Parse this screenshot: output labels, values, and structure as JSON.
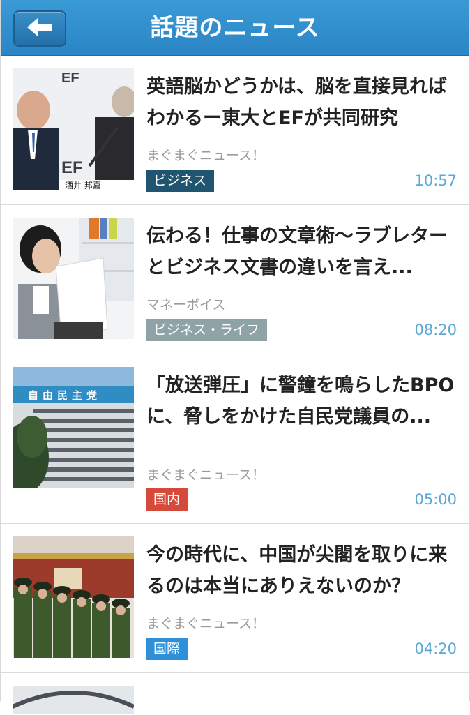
{
  "header": {
    "title": "話題のニュース",
    "back_icon": "arrow-left-icon",
    "color": "#2d8ccb"
  },
  "news": [
    {
      "title": "英語脳かどうかは、脳を直接見ればわかるー東大とEFが共同研究",
      "source": "まぐまぐニュース！",
      "category": "ビジネス",
      "category_color": "#1f5571",
      "time": "10:57",
      "thumb_caption": "酒井 邦嘉",
      "thumb_logo": "EF"
    },
    {
      "title": "伝わる！仕事の文章術〜ラブレターとビジネス文書の違いを言え...",
      "source": "マネーボイス",
      "category": "ビジネス・ライフ",
      "category_color": "#8fa3a6",
      "time": "08:20"
    },
    {
      "title": "「放送弾圧」に警鐘を鳴らしたBPOに、脅しをかけた自民党議員の...",
      "source": "まぐまぐニュース！",
      "category": "国内",
      "category_color": "#d64a3b",
      "time": "05:00",
      "thumb_sign": "自由民主党"
    },
    {
      "title": "今の時代に、中国が尖閣を取りに来るのは本当にありえないのか？",
      "source": "まぐまぐニュース！",
      "category": "国際",
      "category_color": "#2f8fd8",
      "time": "04:20"
    }
  ]
}
